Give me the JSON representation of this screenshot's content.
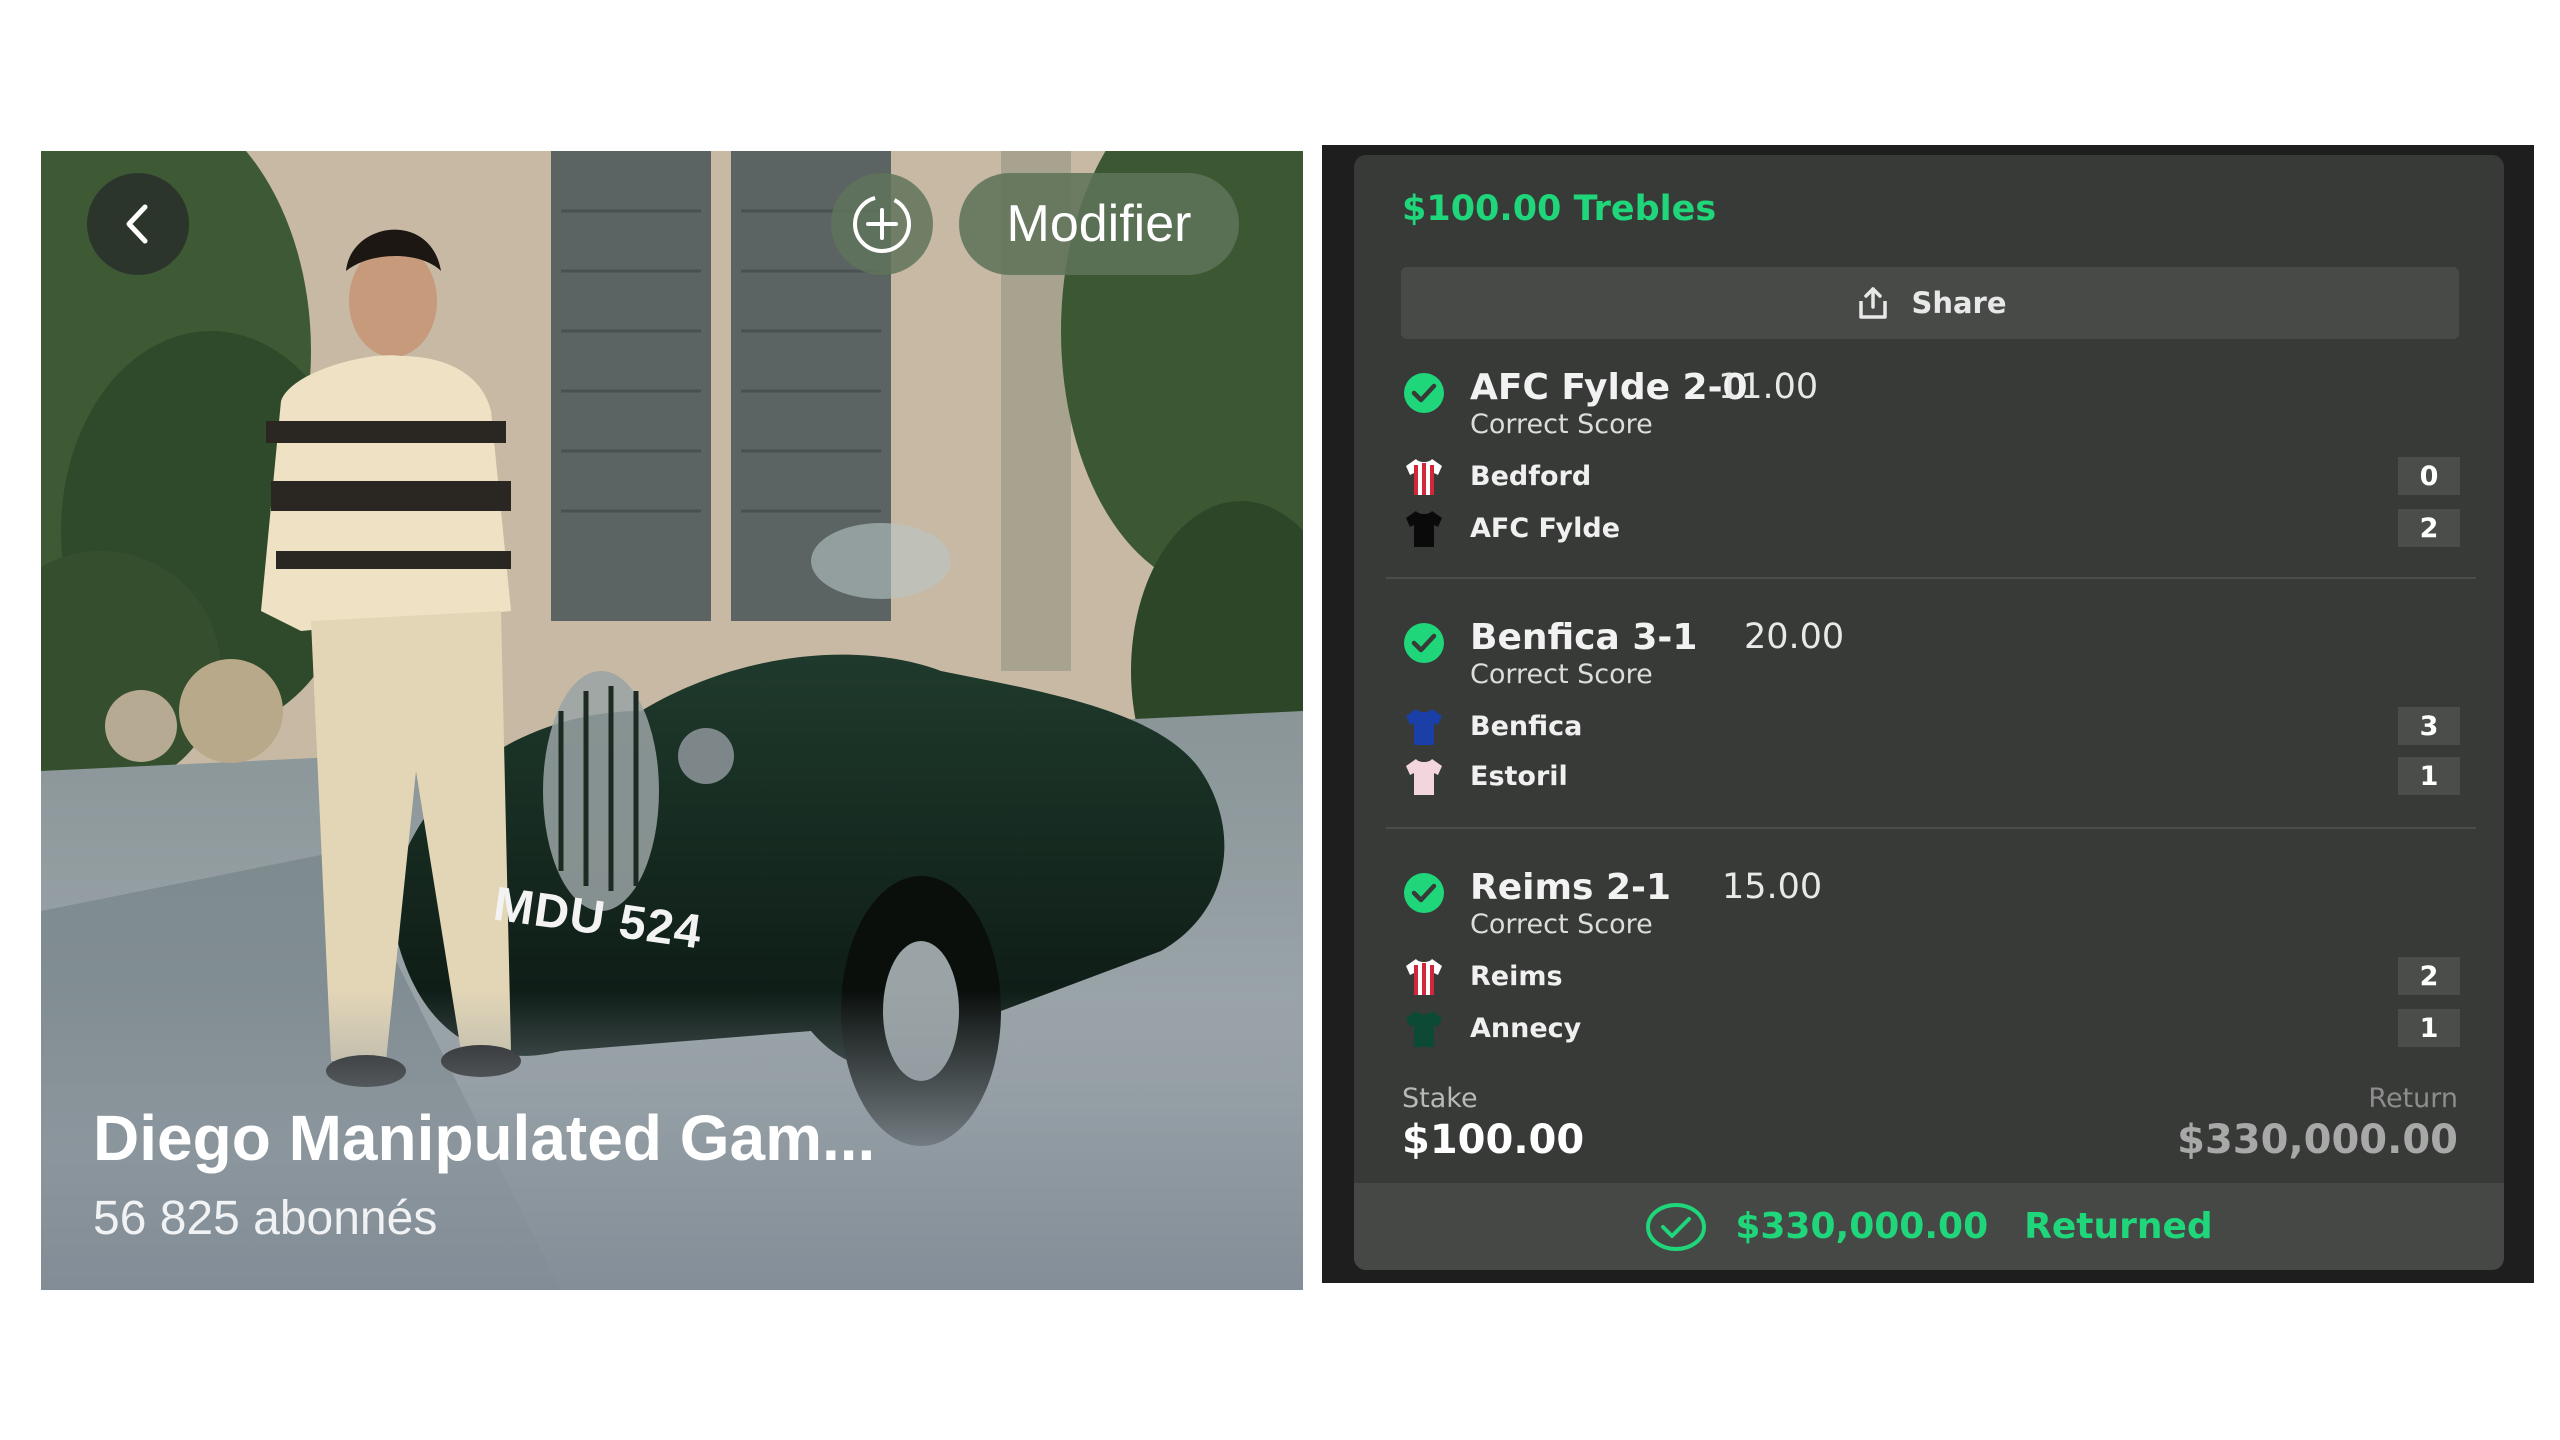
{
  "left_panel": {
    "back_icon": "chevron-left-icon",
    "add_icon": "add-circle-icon",
    "modifier_label": "Modifier",
    "group_title": "Diego Manipulated Gam...",
    "subscribers": "56 825 abonnés",
    "license_plate": "MDU 524"
  },
  "slip": {
    "title": "$100.00 Trebles",
    "share_label": "Share",
    "share_icon": "share-icon",
    "accent_color": "#1fd67a",
    "legs": [
      {
        "title": "AFC Fylde 2-0",
        "odds": "11.00",
        "market": "Correct Score",
        "status_icon": "check-circle-icon",
        "teams": [
          {
            "name": "Bedford",
            "score": "0",
            "shirt": "red-white-stripes"
          },
          {
            "name": "AFC Fylde",
            "score": "2",
            "shirt": "black"
          }
        ]
      },
      {
        "title": "Benfica 3-1",
        "odds": "20.00",
        "market": "Correct Score",
        "status_icon": "check-circle-icon",
        "teams": [
          {
            "name": "Benfica",
            "score": "3",
            "shirt": "blue"
          },
          {
            "name": "Estoril",
            "score": "1",
            "shirt": "pink-white"
          }
        ]
      },
      {
        "title": "Reims 2-1",
        "odds": "15.00",
        "market": "Correct Score",
        "status_icon": "check-circle-icon",
        "teams": [
          {
            "name": "Reims",
            "score": "2",
            "shirt": "red-white-stripes"
          },
          {
            "name": "Annecy",
            "score": "1",
            "shirt": "dark-green"
          }
        ]
      }
    ],
    "stake_label": "Stake",
    "stake_value": "$100.00",
    "return_label": "Return",
    "return_value": "$330,000.00",
    "returned_amount": "$330,000.00",
    "returned_word": "Returned"
  }
}
